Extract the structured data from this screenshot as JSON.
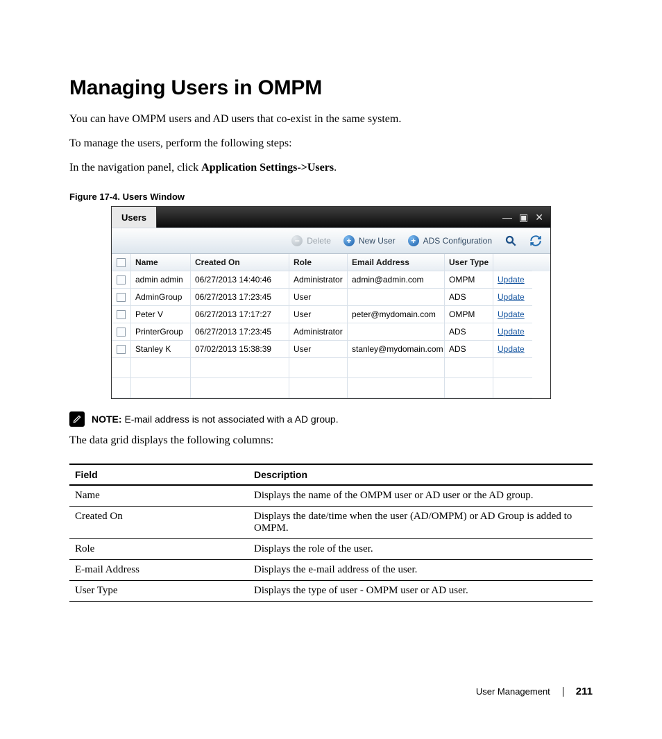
{
  "heading": "Managing Users in OMPM",
  "paragraphs": {
    "p1": "You can have OMPM users and AD users that co-exist in the same system.",
    "p2": "To manage the users, perform the following steps:",
    "p3_prefix": "In the navigation panel, click ",
    "p3_strong": "Application Settings->Users",
    "p3_suffix": "."
  },
  "figure_caption": "Figure 17-4.    Users Window",
  "panel": {
    "tab": "Users",
    "toolbar": {
      "delete": "Delete",
      "new_user": "New User",
      "ads_config": "ADS Configuration"
    },
    "columns": {
      "name": "Name",
      "created": "Created On",
      "role": "Role",
      "email": "Email Address",
      "user_type": "User Type",
      "action": ""
    },
    "rows": [
      {
        "name": "admin admin",
        "created": "06/27/2013 14:40:46",
        "role": "Administrator",
        "email": "admin@admin.com",
        "user_type": "OMPM",
        "action": "Update"
      },
      {
        "name": "AdminGroup",
        "created": "06/27/2013 17:23:45",
        "role": "User",
        "email": "",
        "user_type": "ADS",
        "action": "Update"
      },
      {
        "name": "Peter V",
        "created": "06/27/2013 17:17:27",
        "role": "User",
        "email": "peter@mydomain.com",
        "user_type": "OMPM",
        "action": "Update"
      },
      {
        "name": "PrinterGroup",
        "created": "06/27/2013 17:23:45",
        "role": "Administrator",
        "email": "",
        "user_type": "ADS",
        "action": "Update"
      },
      {
        "name": "Stanley K",
        "created": "07/02/2013 15:38:39",
        "role": "User",
        "email": "stanley@mydomain.com",
        "user_type": "ADS",
        "action": "Update"
      }
    ]
  },
  "note": {
    "label": "NOTE:",
    "text": " E-mail address is not associated with a AD group."
  },
  "after_note": "The data grid displays the following columns:",
  "field_table": {
    "headers": {
      "field": "Field",
      "desc": "Description"
    },
    "rows": [
      {
        "field": "Name",
        "desc": "Displays the name of the OMPM user or AD user or the AD group."
      },
      {
        "field": "Created On",
        "desc": "Displays the date/time when the user (AD/OMPM) or AD Group is added to OMPM."
      },
      {
        "field": "Role",
        "desc": "Displays the role of the user."
      },
      {
        "field": "E-mail Address",
        "desc": "Displays the e-mail address of the user."
      },
      {
        "field": "User Type",
        "desc": "Displays the type of user - OMPM user or AD user."
      }
    ]
  },
  "footer": {
    "section": "User Management",
    "page": "211"
  }
}
